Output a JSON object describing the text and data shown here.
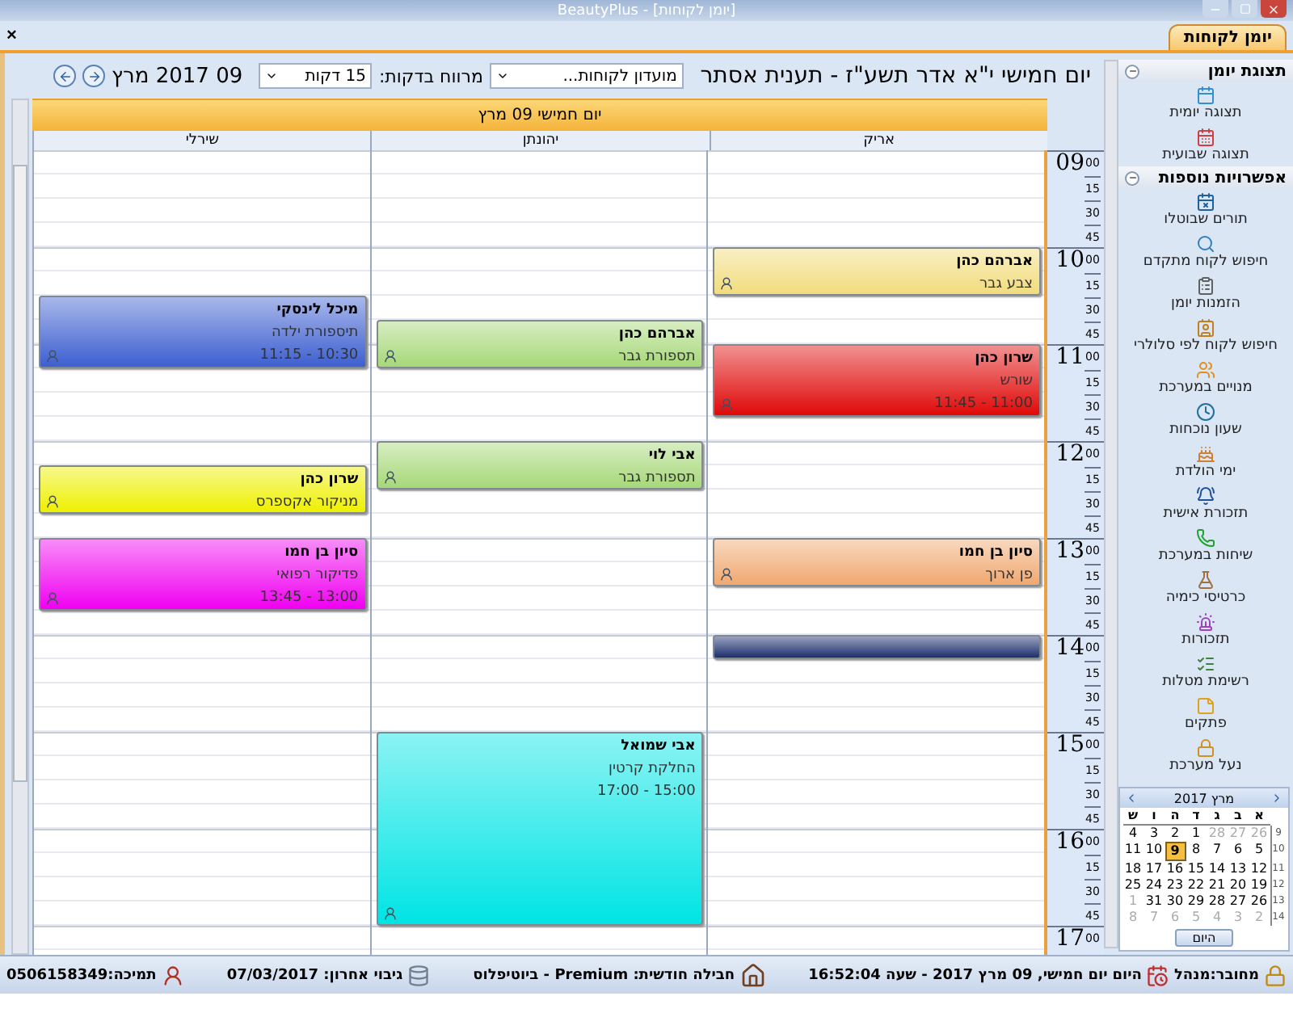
{
  "window": {
    "title": "[יומן לקוחות] - BeautyPlus",
    "close_tab": "×"
  },
  "tabs": [
    {
      "label": "יומן לקוחות",
      "selected": true
    }
  ],
  "toolbar": {
    "heading": "יום חמישי י\"א אדר תשע\"ז - תענית אסתר",
    "club_select": {
      "value": "מועדון לקוחות..."
    },
    "interval_label": "מרווח בדקות:",
    "interval_select": {
      "value": "15 דקות"
    },
    "date": "09 2017 מרץ"
  },
  "day_header": "יום חמישי 09 מרץ",
  "time_axis": [
    {
      "hour": "09",
      "minutes": [
        "00",
        "15",
        "30",
        "45"
      ]
    },
    {
      "hour": "10",
      "minutes": [
        "00",
        "15",
        "30",
        "45"
      ]
    },
    {
      "hour": "11",
      "minutes": [
        "00",
        "15",
        "30",
        "45"
      ]
    },
    {
      "hour": "12",
      "minutes": [
        "00",
        "15",
        "30",
        "45"
      ]
    },
    {
      "hour": "13",
      "minutes": [
        "00",
        "15",
        "30",
        "45"
      ]
    },
    {
      "hour": "14",
      "minutes": [
        "00",
        "15",
        "30",
        "45"
      ]
    },
    {
      "hour": "15",
      "minutes": [
        "00",
        "15",
        "30",
        "45"
      ]
    },
    {
      "hour": "16",
      "minutes": [
        "00",
        "15",
        "30",
        "45"
      ]
    },
    {
      "hour": "17",
      "minutes": [
        "00"
      ]
    }
  ],
  "columns": [
    {
      "name": "אריק",
      "slots": [
        {
          "kind": "free"
        },
        {
          "kind": "free"
        },
        {
          "kind": "free"
        },
        {
          "kind": "free"
        },
        {
          "kind": "appointment",
          "client": "אברהם כהן",
          "service": "צבע גבר",
          "color": "#f2dc7c"
        },
        {
          "kind": "continued"
        },
        {
          "kind": "free"
        },
        {
          "kind": "free"
        },
        {
          "kind": "appointment",
          "client": "שרון כהן",
          "service": "שורש",
          "time": "11:00 - 11:45",
          "color": "#e00808"
        },
        {
          "kind": "continued"
        },
        {
          "kind": "continued"
        },
        {
          "kind": "free"
        },
        {
          "kind": "free"
        },
        {
          "kind": "free"
        },
        {
          "kind": "free"
        },
        {
          "kind": "free"
        },
        {
          "kind": "appointment",
          "client": "סיון בן חמו",
          "service": "פן ארוך",
          "color": "#f0a870"
        },
        {
          "kind": "continued"
        },
        {
          "kind": "free"
        },
        {
          "kind": "free"
        },
        {
          "kind": "appointment",
          "color": "#1c2f6e"
        }
      ]
    },
    {
      "name": "יהונתן",
      "slots": [
        {
          "kind": "free"
        },
        {
          "kind": "free"
        },
        {
          "kind": "free"
        },
        {
          "kind": "free"
        },
        {
          "kind": "free"
        },
        {
          "kind": "free"
        },
        {
          "kind": "free"
        },
        {
          "kind": "appointment",
          "client": "אברהם כהן",
          "service": "תספורת גבר",
          "color": "#a6d878"
        },
        {
          "kind": "continued"
        },
        {
          "kind": "free"
        },
        {
          "kind": "free"
        },
        {
          "kind": "free"
        },
        {
          "kind": "appointment",
          "client": "אבי לוי",
          "service": "תספורת גבר",
          "color": "#a6d878"
        },
        {
          "kind": "continued"
        },
        {
          "kind": "free"
        },
        {
          "kind": "free"
        },
        {
          "kind": "free"
        },
        {
          "kind": "free"
        },
        {
          "kind": "free"
        },
        {
          "kind": "free"
        },
        {
          "kind": "free"
        },
        {
          "kind": "free"
        },
        {
          "kind": "free"
        },
        {
          "kind": "free"
        },
        {
          "kind": "appointment",
          "client": "אבי שמואל",
          "service": "החלקת קרטין",
          "time": "15:00 - 17:00",
          "color": "#00e4e4"
        },
        {
          "kind": "continued"
        },
        {
          "kind": "continued"
        },
        {
          "kind": "continued"
        },
        {
          "kind": "continued"
        },
        {
          "kind": "continued"
        },
        {
          "kind": "continued"
        },
        {
          "kind": "continued"
        }
      ]
    },
    {
      "name": "שירלי",
      "slots": [
        {
          "kind": "free"
        },
        {
          "kind": "free"
        },
        {
          "kind": "free"
        },
        {
          "kind": "free"
        },
        {
          "kind": "free"
        },
        {
          "kind": "free"
        },
        {
          "kind": "appointment",
          "client": "מיכל לינסקי",
          "service": "תיספורת ילדה",
          "time": "10:30 - 11:15",
          "color": "#3d5fd0"
        },
        {
          "kind": "continued"
        },
        {
          "kind": "continued"
        },
        {
          "kind": "free"
        },
        {
          "kind": "free"
        },
        {
          "kind": "free"
        },
        {
          "kind": "free"
        },
        {
          "kind": "appointment",
          "client": "שרון כהן",
          "service": "מניקור אקספרס",
          "color": "#eef000"
        },
        {
          "kind": "continued"
        },
        {
          "kind": "free"
        },
        {
          "kind": "appointment",
          "client": "סיון בן חמו",
          "service": "פדיקור רפואי",
          "time": "13:00 - 13:45",
          "color": "#f000f0"
        },
        {
          "kind": "continued"
        },
        {
          "kind": "continued"
        }
      ]
    }
  ],
  "sidebar": {
    "sections": [
      {
        "title": "תצוגת יומן",
        "expanded": true,
        "items": [
          "תצוגה יומית",
          "תצוגה שבועית"
        ]
      },
      {
        "title": "אפשרויות נוספות",
        "expanded": true,
        "items": [
          "תורים שבוטלו",
          "חיפוש לקוח מתקדם",
          "הזמנות יומן",
          "חיפוש לקוח לפי סלולרי",
          "מנויים במערכת",
          "שעון נוכחות",
          "ימי הולדת",
          "תזכורת אישית",
          "שיחות במערכת",
          "כרטיסי כימיה",
          "תזכורות",
          "רשימת מטלות",
          "פתקים",
          "נעל מערכת"
        ]
      }
    ]
  },
  "mini_calendar": {
    "title": "מרץ 2017",
    "weekdays": [
      "א",
      "ב",
      "ג",
      "ד",
      "ה",
      "ו",
      "ש"
    ],
    "weeks": [
      {
        "number": "9",
        "days": [
          {
            "day": "26",
            "other_month": true,
            "selected": false
          },
          {
            "day": "27",
            "other_month": true,
            "selected": false
          },
          {
            "day": "28",
            "other_month": true,
            "selected": false
          },
          {
            "day": "1",
            "other_month": false,
            "selected": false
          },
          {
            "day": "2",
            "other_month": false,
            "selected": false
          },
          {
            "day": "3",
            "other_month": false,
            "selected": false
          },
          {
            "day": "4",
            "other_month": false,
            "selected": false
          }
        ]
      },
      {
        "number": "10",
        "days": [
          {
            "day": "5",
            "other_month": false,
            "selected": false
          },
          {
            "day": "6",
            "other_month": false,
            "selected": false
          },
          {
            "day": "7",
            "other_month": false,
            "selected": false
          },
          {
            "day": "8",
            "other_month": false,
            "selected": false
          },
          {
            "day": "9",
            "other_month": false,
            "selected": true
          },
          {
            "day": "10",
            "other_month": false,
            "selected": false
          },
          {
            "day": "11",
            "other_month": false,
            "selected": false
          }
        ]
      },
      {
        "number": "11",
        "days": [
          {
            "day": "12",
            "other_month": false,
            "selected": false
          },
          {
            "day": "13",
            "other_month": false,
            "selected": false
          },
          {
            "day": "14",
            "other_month": false,
            "selected": false
          },
          {
            "day": "15",
            "other_month": false,
            "selected": false
          },
          {
            "day": "16",
            "other_month": false,
            "selected": false
          },
          {
            "day": "17",
            "other_month": false,
            "selected": false
          },
          {
            "day": "18",
            "other_month": false,
            "selected": false
          }
        ]
      },
      {
        "number": "12",
        "days": [
          {
            "day": "19",
            "other_month": false,
            "selected": false
          },
          {
            "day": "20",
            "other_month": false,
            "selected": false
          },
          {
            "day": "21",
            "other_month": false,
            "selected": false
          },
          {
            "day": "22",
            "other_month": false,
            "selected": false
          },
          {
            "day": "23",
            "other_month": false,
            "selected": false
          },
          {
            "day": "24",
            "other_month": false,
            "selected": false
          },
          {
            "day": "25",
            "other_month": false,
            "selected": false
          }
        ]
      },
      {
        "number": "13",
        "days": [
          {
            "day": "26",
            "other_month": false,
            "selected": false
          },
          {
            "day": "27",
            "other_month": false,
            "selected": false
          },
          {
            "day": "28",
            "other_month": false,
            "selected": false
          },
          {
            "day": "29",
            "other_month": false,
            "selected": false
          },
          {
            "day": "30",
            "other_month": false,
            "selected": false
          },
          {
            "day": "31",
            "other_month": false,
            "selected": false
          },
          {
            "day": "1",
            "other_month": true,
            "selected": false
          }
        ]
      },
      {
        "number": "14",
        "days": [
          {
            "day": "2",
            "other_month": true,
            "selected": false
          },
          {
            "day": "3",
            "other_month": true,
            "selected": false
          },
          {
            "day": "4",
            "other_month": true,
            "selected": false
          },
          {
            "day": "5",
            "other_month": true,
            "selected": false
          },
          {
            "day": "6",
            "other_month": true,
            "selected": false
          },
          {
            "day": "7",
            "other_month": true,
            "selected": false
          },
          {
            "day": "8",
            "other_month": true,
            "selected": false
          }
        ]
      }
    ],
    "today_button": "היום"
  },
  "status_bar": {
    "user": "מחובר:מנהל",
    "today_label": "היום",
    "datetime": "יום חמישי, 09 מרץ 2017 - שעה 16:52:04",
    "package": "חבילה חודשית: Premium - ביוטיפלוס",
    "backup": "גיבוי אחרון: 07/03/2017",
    "support": "תמיכה:0506158349"
  }
}
